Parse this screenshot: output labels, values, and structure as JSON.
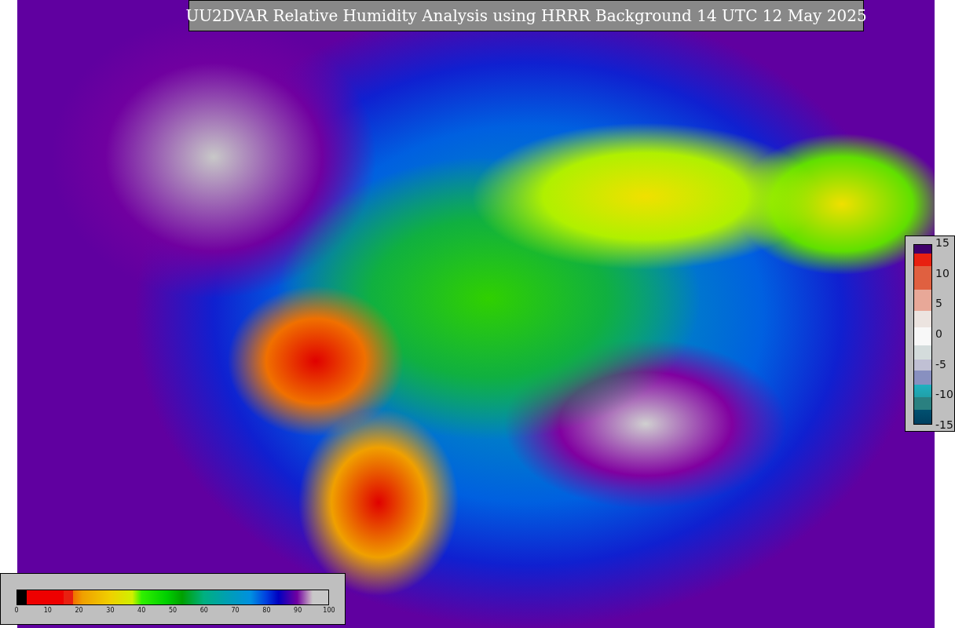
{
  "title": "UU2DVAR Relative Humidity Analysis using HRRR Background 14 UTC 12 May 2025",
  "humidity_colorbar": {
    "ticks": [
      "0",
      "10",
      "20",
      "30",
      "40",
      "50",
      "60",
      "70",
      "80",
      "90",
      "100"
    ]
  },
  "difference_colorbar": {
    "ticks": [
      "15",
      "10",
      "5",
      "0",
      "-5",
      "-10",
      "-15"
    ]
  }
}
